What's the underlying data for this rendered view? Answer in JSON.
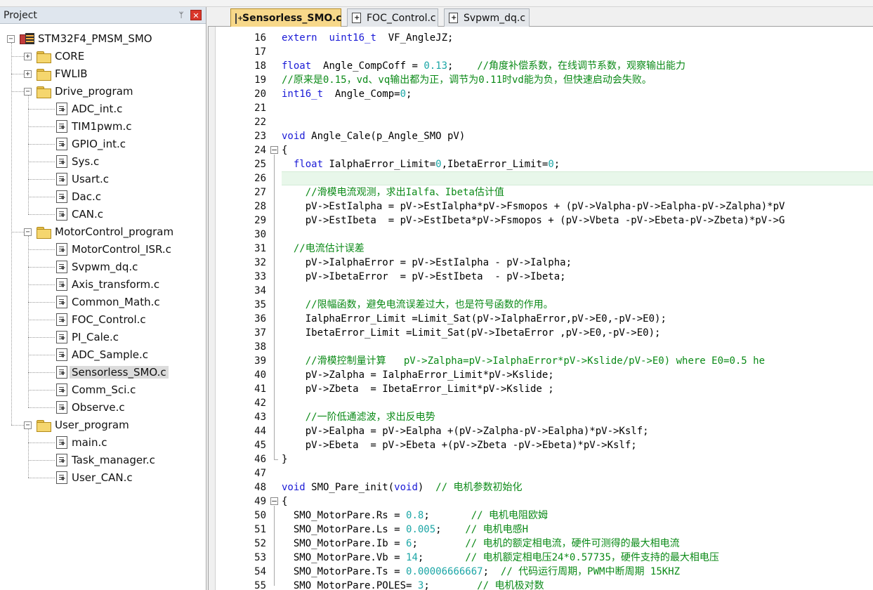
{
  "project_panel": {
    "title": "Project",
    "pin_glyph": "ᛘ",
    "close_glyph": "✕",
    "tree": [
      {
        "label": "STM32F4_PMSM_SMO",
        "level": 0,
        "kind": "project",
        "expander": "−"
      },
      {
        "label": "CORE",
        "level": 1,
        "kind": "folder",
        "expander": "+"
      },
      {
        "label": "FWLIB",
        "level": 1,
        "kind": "folder",
        "expander": "+"
      },
      {
        "label": "Drive_program",
        "level": 1,
        "kind": "folder-open",
        "expander": "−"
      },
      {
        "label": "ADC_int.c",
        "level": 2,
        "kind": "file"
      },
      {
        "label": "TIM1pwm.c",
        "level": 2,
        "kind": "file"
      },
      {
        "label": "GPIO_int.c",
        "level": 2,
        "kind": "file"
      },
      {
        "label": "Sys.c",
        "level": 2,
        "kind": "file"
      },
      {
        "label": "Usart.c",
        "level": 2,
        "kind": "file"
      },
      {
        "label": "Dac.c",
        "level": 2,
        "kind": "file"
      },
      {
        "label": "CAN.c",
        "level": 2,
        "kind": "file"
      },
      {
        "label": "MotorControl_program",
        "level": 1,
        "kind": "folder-open",
        "expander": "−"
      },
      {
        "label": "MotorControl_ISR.c",
        "level": 2,
        "kind": "file"
      },
      {
        "label": "Svpwm_dq.c",
        "level": 2,
        "kind": "file"
      },
      {
        "label": "Axis_transform.c",
        "level": 2,
        "kind": "file"
      },
      {
        "label": "Common_Math.c",
        "level": 2,
        "kind": "file"
      },
      {
        "label": "FOC_Control.c",
        "level": 2,
        "kind": "file"
      },
      {
        "label": "PI_Cale.c",
        "level": 2,
        "kind": "file"
      },
      {
        "label": "ADC_Sample.c",
        "level": 2,
        "kind": "file"
      },
      {
        "label": "Sensorless_SMO.c",
        "level": 2,
        "kind": "file",
        "selected": true
      },
      {
        "label": "Comm_Sci.c",
        "level": 2,
        "kind": "file"
      },
      {
        "label": "Observe.c",
        "level": 2,
        "kind": "file"
      },
      {
        "label": "User_program",
        "level": 1,
        "kind": "folder-open",
        "expander": "−"
      },
      {
        "label": "main.c",
        "level": 2,
        "kind": "file"
      },
      {
        "label": "Task_manager.c",
        "level": 2,
        "kind": "file"
      },
      {
        "label": "User_CAN.c",
        "level": 2,
        "kind": "file"
      }
    ]
  },
  "tabs": [
    {
      "label": "Sensorless_SMO.c",
      "active": true
    },
    {
      "label": "FOC_Control.c",
      "active": false
    },
    {
      "label": "Svpwm_dq.c",
      "active": false
    }
  ],
  "editor": {
    "highlight_line": 26,
    "fold_markers": [
      {
        "line": 24,
        "glyph": "−",
        "end": 46
      },
      {
        "line": 49,
        "glyph": "−",
        "end": 55
      }
    ],
    "lines": [
      {
        "n": "16",
        "t": [
          [
            "kw",
            "extern"
          ],
          [
            "",
            "  "
          ],
          [
            "kw",
            "uint16_t"
          ],
          [
            "",
            "  VF_AngleJZ;"
          ]
        ]
      },
      {
        "n": "17",
        "t": []
      },
      {
        "n": "18",
        "t": [
          [
            "kw",
            "float"
          ],
          [
            "",
            "  Angle_CompCoff = "
          ],
          [
            "num",
            "0.13"
          ],
          [
            "",
            ";    "
          ],
          [
            "cmt",
            "//角度补偿系数，在线调节系数，观察输出能力"
          ]
        ]
      },
      {
        "n": "19",
        "t": [
          [
            "cmt",
            "//原来是0.15，vd、vq输出都为正，调节为0.11时vd能为负，但快速启动会失败。"
          ]
        ]
      },
      {
        "n": "20",
        "t": [
          [
            "kw",
            "int16_t"
          ],
          [
            "",
            "  Angle_Comp="
          ],
          [
            "num",
            "0"
          ],
          [
            "",
            ";"
          ]
        ]
      },
      {
        "n": "21",
        "t": []
      },
      {
        "n": "22",
        "t": []
      },
      {
        "n": "23",
        "t": [
          [
            "kw",
            "void"
          ],
          [
            "",
            " Angle_Cale(p_Angle_SMO pV)"
          ]
        ]
      },
      {
        "n": "24",
        "t": [
          [
            "",
            "{"
          ]
        ]
      },
      {
        "n": "25",
        "t": [
          [
            "",
            "  "
          ],
          [
            "kw",
            "float"
          ],
          [
            "",
            " IalphaError_Limit="
          ],
          [
            "num",
            "0"
          ],
          [
            "",
            ",IbetaError_Limit="
          ],
          [
            "num",
            "0"
          ],
          [
            "",
            ";"
          ]
        ]
      },
      {
        "n": "26",
        "t": []
      },
      {
        "n": "27",
        "t": [
          [
            "",
            "    "
          ],
          [
            "cmt",
            "//滑模电流观测，求出Ialfa、Ibeta估计值"
          ]
        ]
      },
      {
        "n": "28",
        "t": [
          [
            "",
            "    pV->EstIalpha = pV->EstIalpha*pV->Fsmopos + (pV->Valpha-pV->Ealpha-pV->Zalpha)*pV"
          ]
        ]
      },
      {
        "n": "29",
        "t": [
          [
            "",
            "    pV->EstIbeta  = pV->EstIbeta*pV->Fsmopos + (pV->Vbeta -pV->Ebeta-pV->Zbeta)*pV->G"
          ]
        ]
      },
      {
        "n": "30",
        "t": []
      },
      {
        "n": "31",
        "t": [
          [
            "",
            "  "
          ],
          [
            "cmt",
            "//电流估计误差"
          ]
        ]
      },
      {
        "n": "32",
        "t": [
          [
            "",
            "    pV->IalphaError = pV->EstIalpha - pV->Ialpha;"
          ]
        ]
      },
      {
        "n": "33",
        "t": [
          [
            "",
            "    pV->IbetaError  = pV->EstIbeta  - pV->Ibeta;"
          ]
        ]
      },
      {
        "n": "34",
        "t": []
      },
      {
        "n": "35",
        "t": [
          [
            "",
            "    "
          ],
          [
            "cmt",
            "//限幅函数，避免电流误差过大，也是符号函数的作用。"
          ]
        ]
      },
      {
        "n": "36",
        "t": [
          [
            "",
            "    IalphaError_Limit =Limit_Sat(pV->IalphaError,pV->E0,-pV->E0);"
          ]
        ]
      },
      {
        "n": "37",
        "t": [
          [
            "",
            "    IbetaError_Limit =Limit_Sat(pV->IbetaError ,pV->E0,-pV->E0);"
          ]
        ]
      },
      {
        "n": "38",
        "t": []
      },
      {
        "n": "39",
        "t": [
          [
            "",
            "    "
          ],
          [
            "cmt",
            "//滑模控制量计算   pV->Zalpha=pV->IalphaError*pV->Kslide/pV->E0) where E0=0.5 he"
          ]
        ]
      },
      {
        "n": "40",
        "t": [
          [
            "",
            "    pV->Zalpha = IalphaError_Limit*pV->Kslide;"
          ]
        ]
      },
      {
        "n": "41",
        "t": [
          [
            "",
            "    pV->Zbeta  = IbetaError_Limit*pV->Kslide ;"
          ]
        ]
      },
      {
        "n": "42",
        "t": []
      },
      {
        "n": "43",
        "t": [
          [
            "",
            "    "
          ],
          [
            "cmt",
            "//一阶低通滤波，求出反电势"
          ]
        ]
      },
      {
        "n": "44",
        "t": [
          [
            "",
            "    pV->Ealpha = pV->Ealpha +(pV->Zalpha-pV->Ealpha)*pV->Kslf;"
          ]
        ]
      },
      {
        "n": "45",
        "t": [
          [
            "",
            "    pV->Ebeta  = pV->Ebeta +(pV->Zbeta -pV->Ebeta)*pV->Kslf;"
          ]
        ]
      },
      {
        "n": "46",
        "t": [
          [
            "",
            "}"
          ]
        ]
      },
      {
        "n": "47",
        "t": []
      },
      {
        "n": "48",
        "t": [
          [
            "kw",
            "void"
          ],
          [
            "",
            " SMO_Pare_init("
          ],
          [
            "kw",
            "void"
          ],
          [
            "",
            ")  "
          ],
          [
            "cmt",
            "// 电机参数初始化"
          ]
        ]
      },
      {
        "n": "49",
        "t": [
          [
            "",
            "{"
          ]
        ]
      },
      {
        "n": "50",
        "t": [
          [
            "",
            "  SMO_MotorPare.Rs = "
          ],
          [
            "num",
            "0.8"
          ],
          [
            "",
            ";       "
          ],
          [
            "cmt",
            "// 电机电阻欧姆"
          ]
        ]
      },
      {
        "n": "51",
        "t": [
          [
            "",
            "  SMO_MotorPare.Ls = "
          ],
          [
            "num",
            "0.005"
          ],
          [
            "",
            ";    "
          ],
          [
            "cmt",
            "// 电机电感H"
          ]
        ]
      },
      {
        "n": "52",
        "t": [
          [
            "",
            "  SMO_MotorPare.Ib = "
          ],
          [
            "num",
            "6"
          ],
          [
            "",
            ";        "
          ],
          [
            "cmt",
            "// 电机的额定相电流，硬件可测得的最大相电流"
          ]
        ]
      },
      {
        "n": "53",
        "t": [
          [
            "",
            "  SMO_MotorPare.Vb = "
          ],
          [
            "num",
            "14"
          ],
          [
            "",
            ";       "
          ],
          [
            "cmt",
            "// 电机额定相电压24*0.57735，硬件支持的最大相电压"
          ]
        ]
      },
      {
        "n": "54",
        "t": [
          [
            "",
            "  SMO_MotorPare.Ts = "
          ],
          [
            "num",
            "0.00006666667"
          ],
          [
            "",
            ";  "
          ],
          [
            "cmt",
            "// 代码运行周期，PWM中断周期 15KHZ"
          ]
        ]
      },
      {
        "n": "55",
        "t": [
          [
            "",
            "  SMO_MotorPare.POLES= "
          ],
          [
            "num",
            "3"
          ],
          [
            "",
            ";        "
          ],
          [
            "cmt",
            "// 电机极对数"
          ]
        ]
      }
    ]
  }
}
